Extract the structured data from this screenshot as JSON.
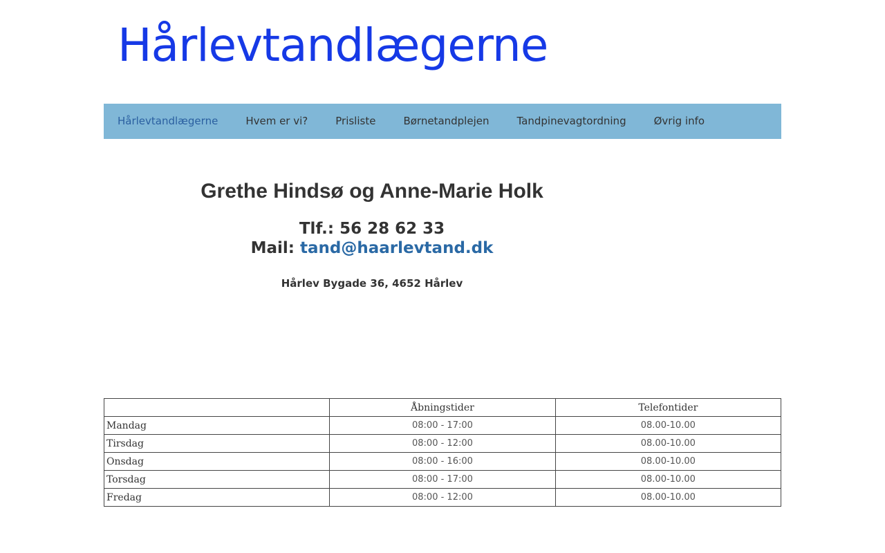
{
  "site": {
    "title": "Hårlevtandlægerne",
    "title_color": "#1639e6"
  },
  "nav": {
    "background": "#80b7d7",
    "items": [
      {
        "label": "Hårlevtandlægerne",
        "active": true
      },
      {
        "label": "Hvem er vi?"
      },
      {
        "label": "Prisliste"
      },
      {
        "label": "Børnetandplejen"
      },
      {
        "label": "Tandpinevagtordning"
      },
      {
        "label": "Øvrig info"
      }
    ]
  },
  "main": {
    "heading": "Grethe Hindsø og Anne-Marie Holk",
    "phone_label": "Tlf.:",
    "phone": "56 28 62 33",
    "mail_label": "Mail:",
    "email": "tand@haarlevtand.dk",
    "address": "Hårlev Bygade 36, 4652 Hårlev"
  },
  "hours_table": {
    "headers": [
      "",
      "Åbningstider",
      "Telefontider"
    ],
    "rows": [
      {
        "day": "Mandag",
        "opening": "08:00 - 17:00",
        "phone": "08.00-10.00"
      },
      {
        "day": "Tirsdag",
        "opening": "08:00 - 12:00",
        "phone": "08.00-10.00"
      },
      {
        "day": "Onsdag",
        "opening": "08:00 - 16:00",
        "phone": "08.00-10.00"
      },
      {
        "day": "Torsdag",
        "opening": "08:00 - 17:00",
        "phone": "08.00-10.00"
      },
      {
        "day": "Fredag",
        "opening": "08:00 - 12:00",
        "phone": "08.00-10.00"
      }
    ]
  }
}
